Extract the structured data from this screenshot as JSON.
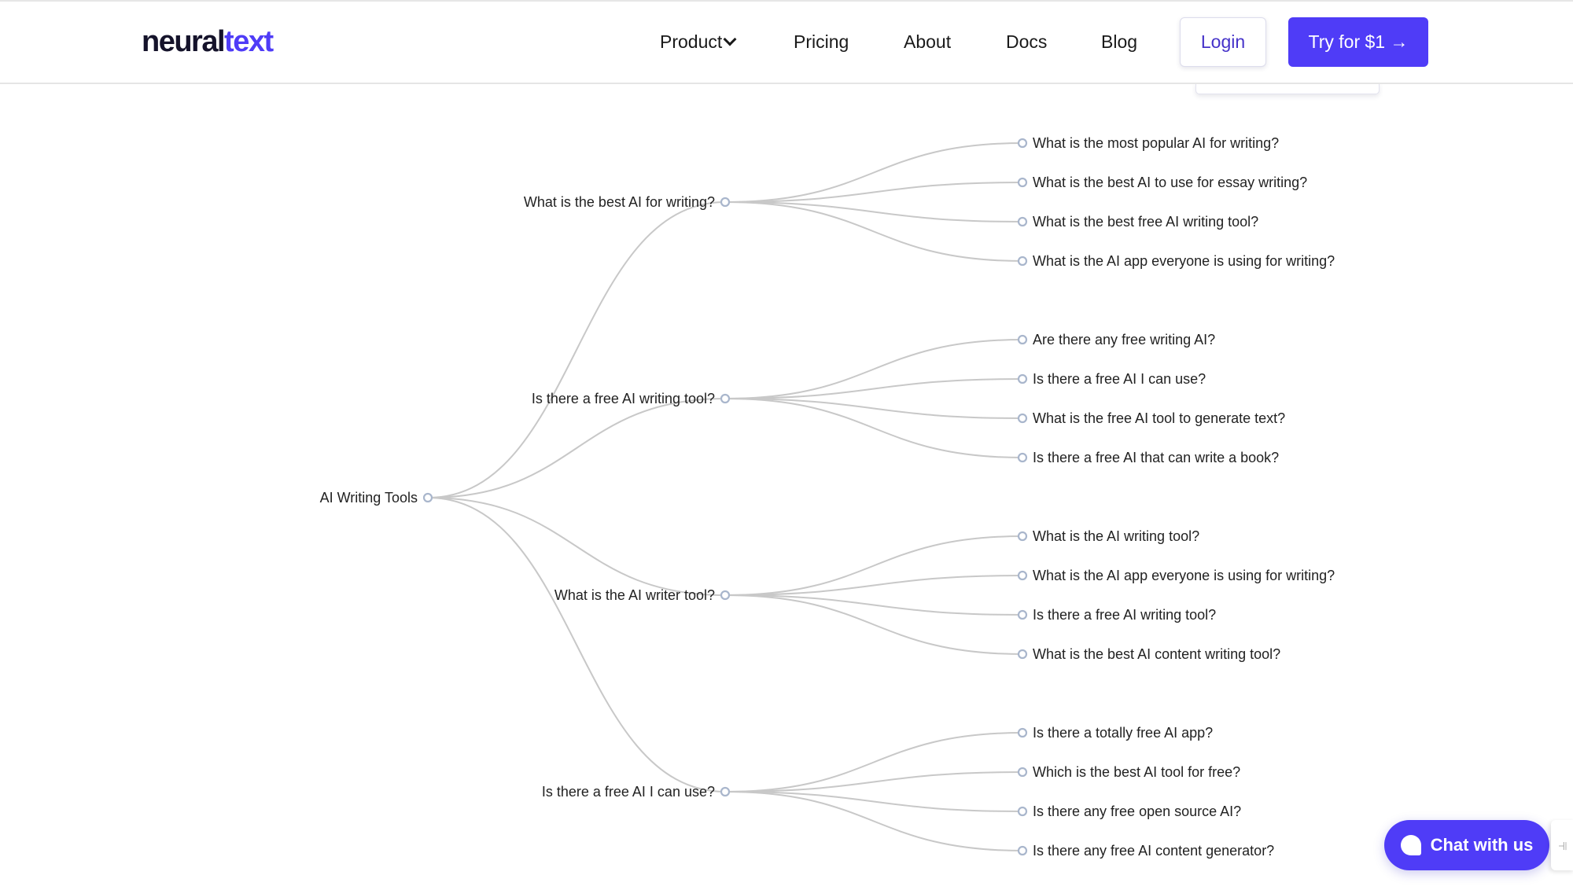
{
  "nav": {
    "logo_part1": "neural",
    "logo_part2": "text",
    "items": [
      "Product",
      "Pricing",
      "About",
      "Docs",
      "Blog"
    ],
    "login_label": "Login",
    "cta_label": "Try for $1 →"
  },
  "colors": {
    "brand": "#4f3cf7",
    "link": "#c8c8c8",
    "node_stroke": "#a9b6cc"
  },
  "tree": {
    "root": "AI Writing Tools",
    "branches": [
      {
        "label": "What is the best AI for writing?",
        "children": [
          "What is the most popular AI for writing?",
          "What is the best AI to use for essay writing?",
          "What is the best free AI writing tool?",
          "What is the AI app everyone is using for writing?"
        ]
      },
      {
        "label": "Is there a free AI writing tool?",
        "children": [
          "Are there any free writing AI?",
          "Is there a free AI I can use?",
          "What is the free AI tool to generate text?",
          "Is there a free AI that can write a book?"
        ]
      },
      {
        "label": "What is the AI writer tool?",
        "children": [
          "What is the AI writing tool?",
          "What is the AI app everyone is using for writing?",
          "Is there a free AI writing tool?",
          "What is the best AI content writing tool?"
        ]
      },
      {
        "label": "Is there a free AI I can use?",
        "children": [
          "Is there a totally free AI app?",
          "Which is the best AI tool for free?",
          "Is there any free open source AI?",
          "Is there any free AI content generator?"
        ]
      }
    ]
  },
  "chat": {
    "label": "Chat with us",
    "icon": "chat-bubble-icon",
    "side_icon": "widget-icon"
  }
}
